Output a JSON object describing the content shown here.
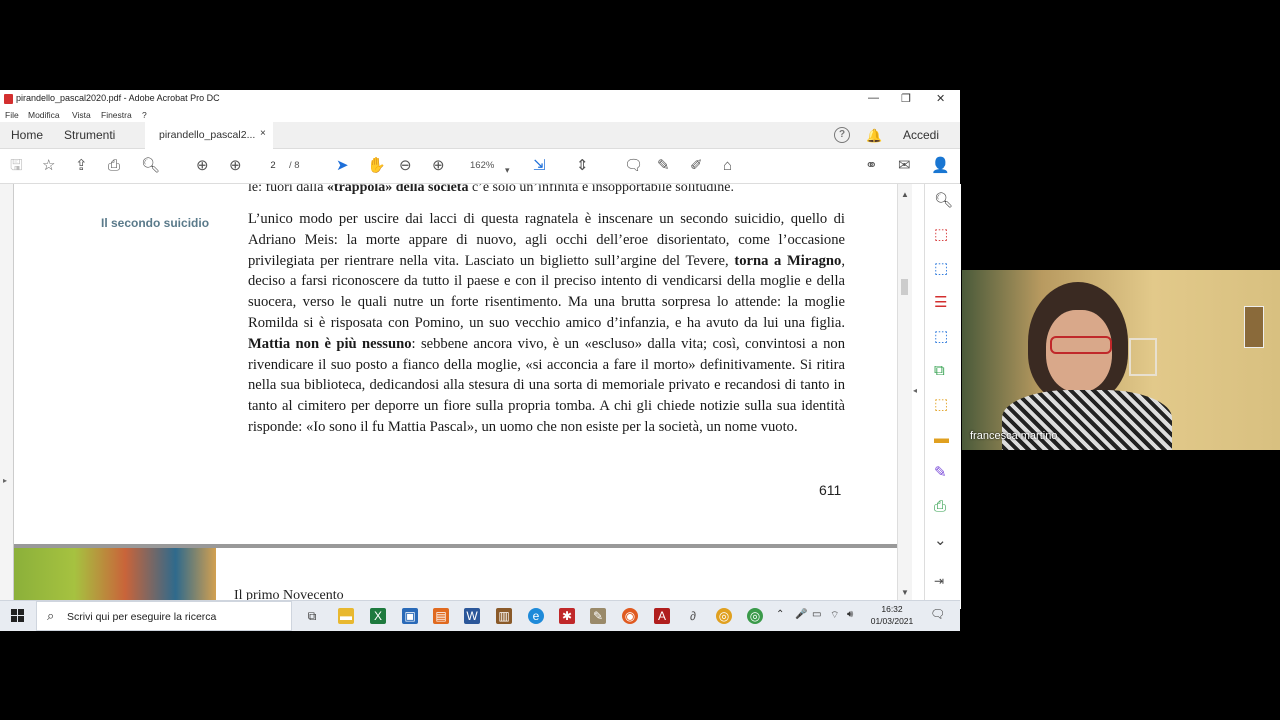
{
  "window": {
    "title": "pirandello_pascal2020.pdf - Adobe Acrobat Pro DC",
    "controls": {
      "minimize": "—",
      "restore": "❐",
      "close": "✕"
    }
  },
  "menu": [
    "File",
    "Modifica",
    "Vista",
    "Finestra",
    "?"
  ],
  "tabs": {
    "home": "Home",
    "tools": "Strumenti",
    "document": "pirandello_pascal2...",
    "close": "×",
    "signin": "Accedi",
    "help": "?"
  },
  "toolbar": {
    "page_current": "2",
    "page_total": "/ 8",
    "zoom": "162%"
  },
  "document": {
    "top_line_plain1": "le: fuori dalla ",
    "top_line_bold": "«trappola» della società",
    "top_line_plain2": " c’è solo un’infinita e insopportabile solitudine.",
    "section_label": "Il secondo suicidio",
    "p1": "L’unico modo per uscire dai lacci di questa ragnatela è inscenare un secondo suicidio, quello di Adriano Meis: la morte appare di nuovo, agli occhi dell’eroe disorientato, come l’occasione privilegiata per rientrare nella vita. Lasciato un biglietto sull’argine del Tevere, ",
    "b1": "torna a Miragno",
    "p2": ", deciso a farsi riconoscere da tutto il paese e con il preciso intento di vendicarsi della moglie e della suocera, verso le quali nutre un forte risentimento. Ma una brutta sorpresa lo attende: la moglie Romilda si è risposata con Pomino, un suo vecchio amico d’infanzia, e ha avuto da lui una figlia. ",
    "b2": "Mattia non è più nessuno",
    "p3": ": sebbene ancora vivo, è un «escluso» dalla vita; così, convintosi a non rivendicare il suo posto a fianco della moglie, «si acconcia a fare il morto» definitivamente. Si ritira nella sua biblioteca, dedicandosi alla stesura di una sorta di memoriale privato e recandosi di tanto in tanto al cimitero per deporre un fiore sulla propria tomba. A chi gli chiede notizie sulla sua identità risponde: «Io sono il fu Mattia Pascal», un uomo che non esiste per la società, un nome vuoto.",
    "page_number": "611",
    "next_page_title": "Il primo Novecento"
  },
  "taskbar": {
    "search_placeholder": "Scrivi qui per eseguire la ricerca",
    "time": "16:32",
    "date": "01/03/2021"
  },
  "video": {
    "participant_name": "francesca martino"
  },
  "colors": {
    "section_label": "#5a7a8a",
    "acrobat_red": "#d32f2f",
    "toolbar_blue": "#1e6fd9"
  }
}
